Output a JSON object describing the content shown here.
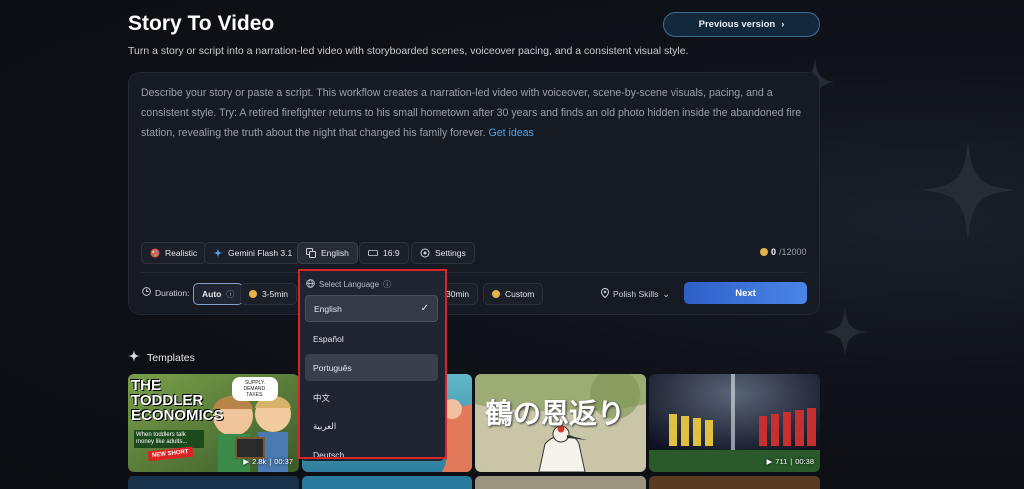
{
  "header": {
    "title": "Story To Video",
    "subtitle": "Turn a story or script into a narration-led video with storyboarded scenes, voiceover pacing, and a consistent visual style.",
    "previous_version_label": "Previous version"
  },
  "prompt": {
    "placeholder": "Describe your story or paste a script. This workflow creates a narration-led video with voiceover, scene-by-scene visuals, pacing, and a consistent style. Try: A retired firefighter returns to his small hometown after 30 years and finds an old photo hidden inside the abandoned fire station, revealing the truth about the night that changed his family forever.",
    "get_ideas_label": "Get ideas"
  },
  "options": {
    "style": "Realistic",
    "model": "Gemini Flash 3.1",
    "language": "English",
    "aspect": "16:9",
    "settings": "Settings"
  },
  "credits": {
    "used": "0",
    "total": "/12000"
  },
  "duration": {
    "label": "Duration:",
    "auto": "Auto",
    "opt1": "3-5min",
    "opt_partial": "30min",
    "custom": "Custom"
  },
  "polish_label": "Polish Skills",
  "next_label": "Next",
  "language_menu": {
    "title": "Select Language",
    "items": [
      "English",
      "Español",
      "Português",
      "中文",
      "العربية",
      "Deutsch"
    ],
    "selected_index": 0,
    "hover_index": 2
  },
  "templates": {
    "title": "Templates",
    "items": [
      {
        "name": "Toddler Economics",
        "headline": "THE TODDLER ECONOMICS",
        "tag": "NEW SHORT",
        "caption": "When toddlers talk money like adults...",
        "bubble": "SUPPLY. DEMAND. TAXES.",
        "views": "2.8k",
        "duration": "00:37"
      },
      {
        "name": "Mermaid",
        "views": "",
        "duration": ""
      },
      {
        "name": "Crane Gratitude",
        "headline": "鶴の恩返り",
        "views": "",
        "duration": ""
      },
      {
        "name": "Stadium Lineup",
        "views": "711",
        "duration": "00:38"
      }
    ]
  },
  "colors": {
    "accent": "#4a86e6",
    "link": "#4aa3f0",
    "highlight": "#d6262b"
  }
}
